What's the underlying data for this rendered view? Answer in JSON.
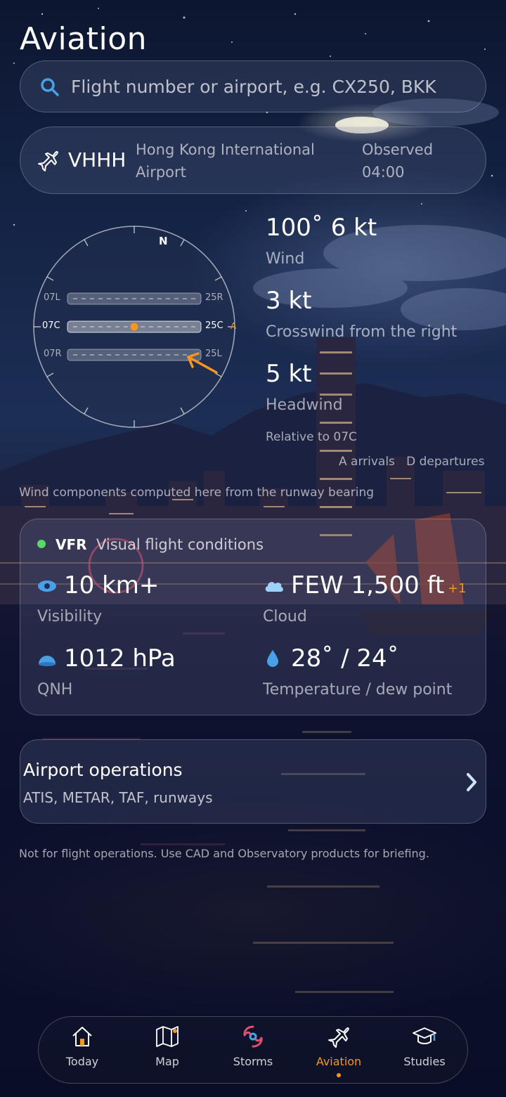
{
  "header": {
    "title": "Aviation"
  },
  "search": {
    "placeholder": "Flight number or airport, e.g. CX250, BKK"
  },
  "airport": {
    "code": "VHHH",
    "name_line1": "Hong Kong International",
    "name_line2": "Airport",
    "observed_label": "Observed",
    "observed_time": "04:00"
  },
  "wind_dial": {
    "north_label": "N",
    "runways": [
      {
        "left": "07L",
        "right": "25R",
        "active": false
      },
      {
        "left": "07C",
        "right": "25C",
        "active": true,
        "marker": "A"
      },
      {
        "left": "07R",
        "right": "25L",
        "active": false
      }
    ]
  },
  "wind": {
    "direction_speed": "100˚ 6 kt",
    "wind_label": "Wind",
    "crosswind_value": "3 kt",
    "crosswind_label": "Crosswind from the right",
    "headwind_value": "5 kt",
    "headwind_label": "Headwind",
    "relative_to": "Relative to 07C",
    "legend": "A arrivals   D departures",
    "footnote": "Wind components computed here from the runway bearing"
  },
  "conditions": {
    "category": "VFR",
    "category_desc": "Visual flight conditions",
    "visibility_value": "10 km+",
    "visibility_label": "Visibility",
    "cloud_value": "FEW 1,500 ft",
    "cloud_extra": "+1",
    "cloud_label": "Cloud",
    "qnh_value": "1012 hPa",
    "qnh_label": "QNH",
    "temp_value": "28˚ / 24˚",
    "temp_label": "Temperature / dew point"
  },
  "operations": {
    "title": "Airport operations",
    "subtitle": "ATIS, METAR, TAF, runways"
  },
  "disclaimer": "Not for flight operations. Use CAD and Observatory products for briefing.",
  "nav": {
    "items": [
      {
        "label": "Today",
        "icon": "house-icon"
      },
      {
        "label": "Map",
        "icon": "map-icon"
      },
      {
        "label": "Storms",
        "icon": "storm-icon"
      },
      {
        "label": "Aviation",
        "icon": "plane-icon",
        "active": true
      },
      {
        "label": "Studies",
        "icon": "graduation-cap-icon"
      }
    ]
  },
  "colors": {
    "accent": "#f5961e",
    "vfr_green": "#5bd66a"
  }
}
